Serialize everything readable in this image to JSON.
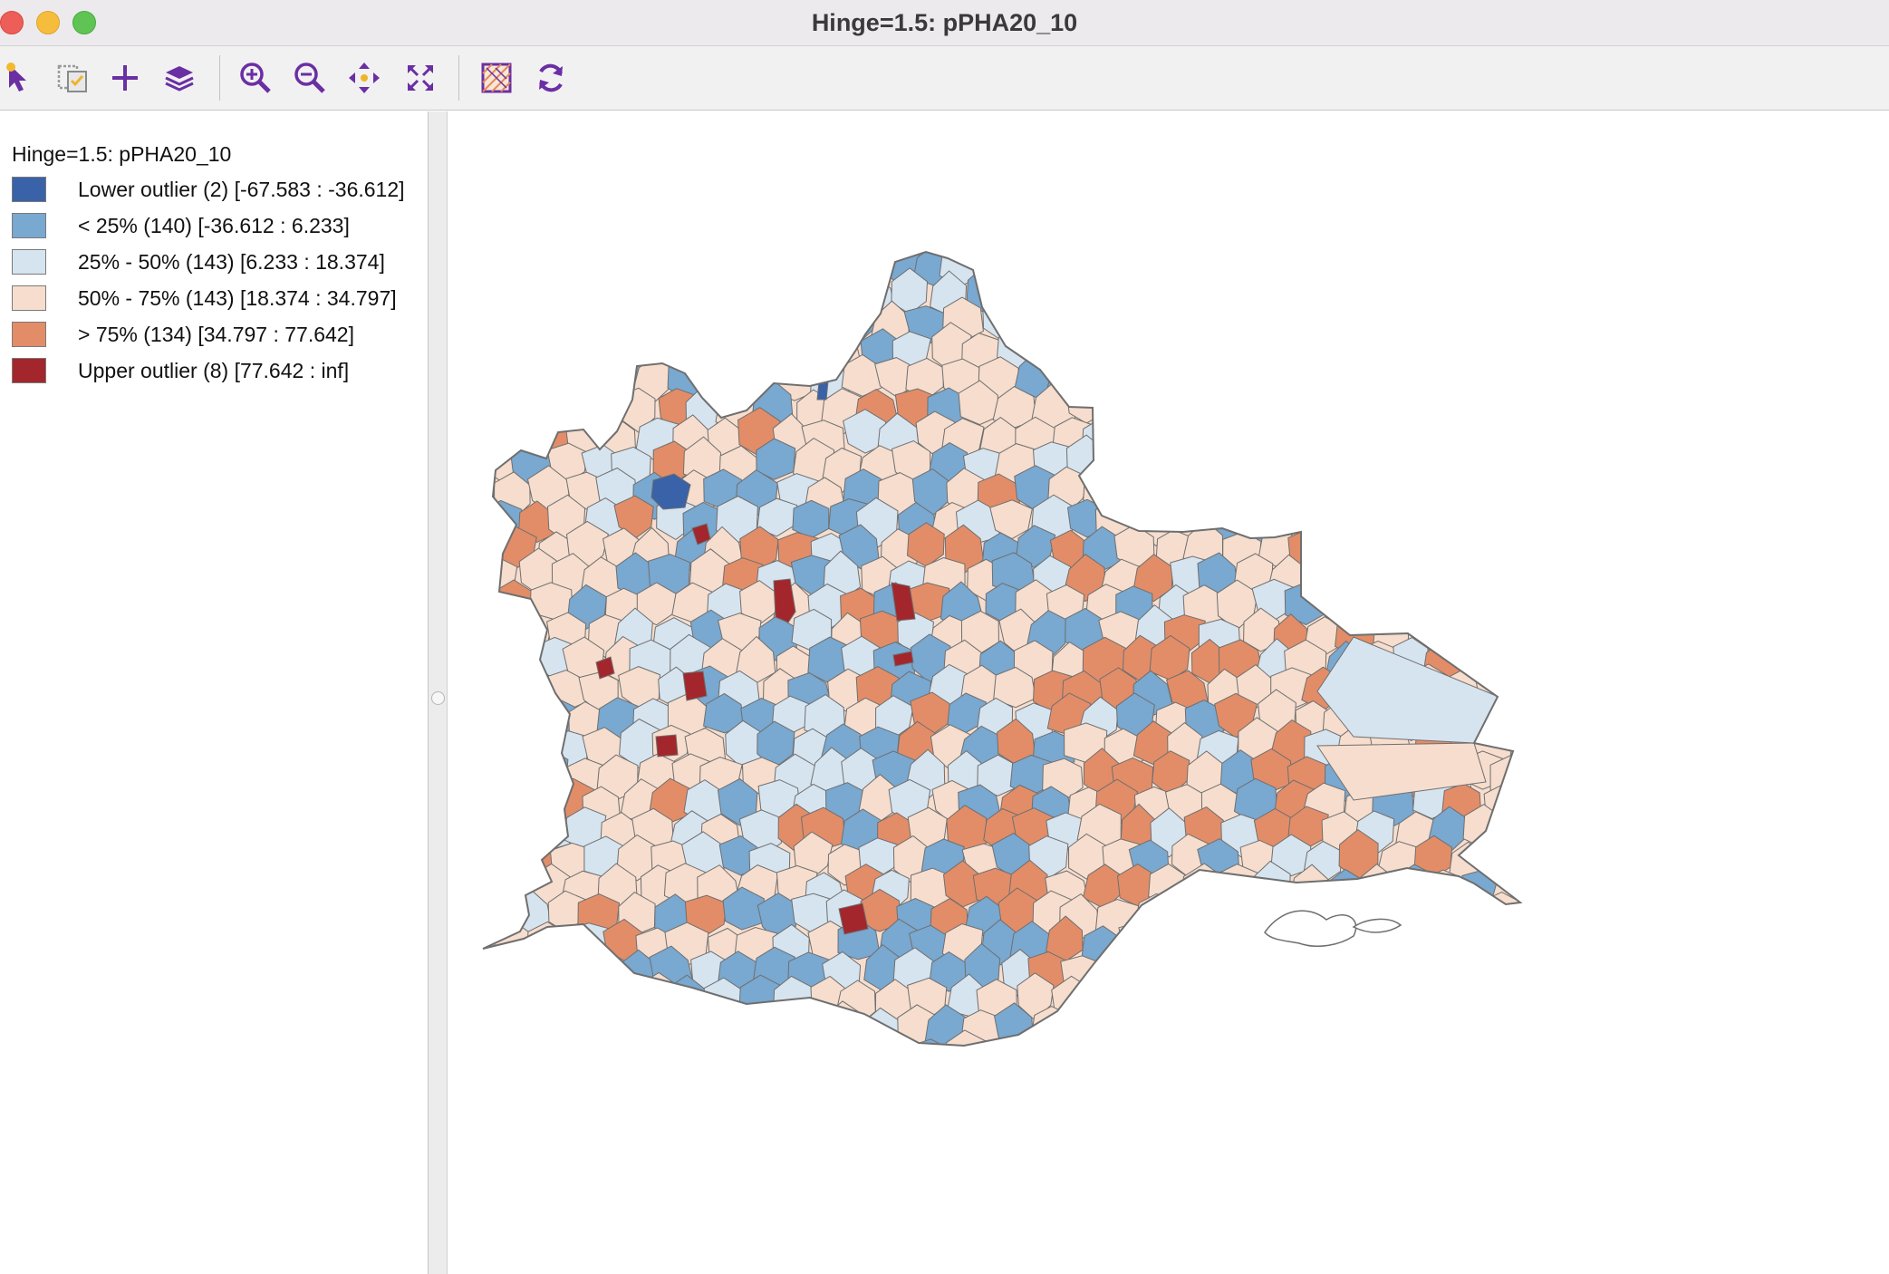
{
  "window": {
    "title": "Hinge=1.5: pPHA20_10"
  },
  "toolbar": {
    "buttons": [
      {
        "icon": "select-pointer-icon"
      },
      {
        "icon": "selection-shape-icon"
      },
      {
        "icon": "add-plus-icon"
      },
      {
        "icon": "layers-icon"
      },
      {
        "icon": "zoom-in-icon"
      },
      {
        "icon": "zoom-out-icon"
      },
      {
        "icon": "pan-icon"
      },
      {
        "icon": "full-extent-icon"
      },
      {
        "icon": "basemap-icon"
      },
      {
        "icon": "refresh-icon"
      }
    ]
  },
  "legend": {
    "title": "Hinge=1.5: pPHA20_10",
    "items": [
      {
        "label": "Lower outlier (2)  [-67.583 : -36.612]",
        "color": "#3a62a8"
      },
      {
        "label": "< 25% (140)  [-36.612 : 6.233]",
        "color": "#79a8d0"
      },
      {
        "label": "25% - 50% (143)  [6.233 : 18.374]",
        "color": "#d6e4f0"
      },
      {
        "label": "50% - 75% (143)  [18.374 : 34.797]",
        "color": "#f6ddcd"
      },
      {
        "label": "> 75% (134)  [34.797 : 77.642]",
        "color": "#e28d68"
      },
      {
        "label": "Upper outlier (8)  [77.642 : inf]",
        "color": "#a3262c"
      }
    ]
  },
  "colors": {
    "lower_outlier": "#3a62a8",
    "q1": "#79a8d0",
    "q2": "#d6e4f0",
    "q3": "#f6ddcd",
    "q4": "#e28d68",
    "upper_outlier": "#a3262c",
    "boundary": "#6f6f6f",
    "icon": "#6a2fa3"
  }
}
